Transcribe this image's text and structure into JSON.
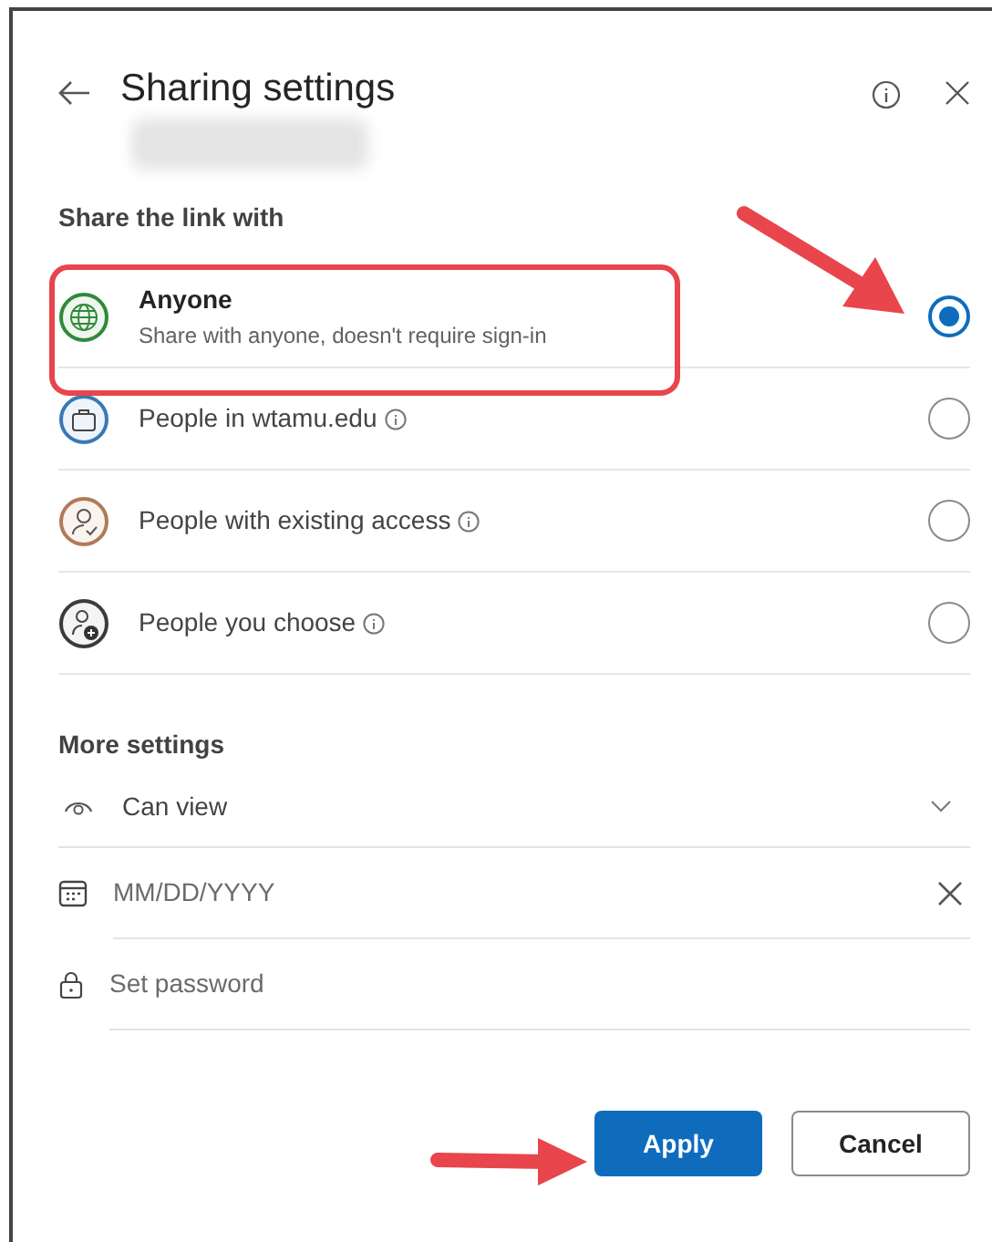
{
  "dialog": {
    "title": "Sharing settings"
  },
  "share_section": {
    "heading": "Share the link with",
    "options": [
      {
        "kind": "globe",
        "label": "Anyone",
        "description": "Share with anyone, doesn't require sign-in",
        "has_info": false,
        "selected": true,
        "color": "#2f8a3a"
      },
      {
        "kind": "organization",
        "label": "People in wtamu.edu",
        "has_info": true,
        "selected": false,
        "color": "#3a78b5"
      },
      {
        "kind": "existing",
        "label": "People with existing access",
        "has_info": true,
        "selected": false,
        "color": "#b07a5a"
      },
      {
        "kind": "specific",
        "label": "People you choose",
        "has_info": true,
        "selected": false,
        "color": "#3b3b3b"
      }
    ]
  },
  "more_settings": {
    "heading": "More settings",
    "permission": "Can view",
    "expiry": {
      "placeholder": "MM/DD/YYYY"
    },
    "password": {
      "placeholder": "Set password"
    }
  },
  "buttons": [
    {
      "label": "Apply",
      "kind": "primary"
    },
    {
      "label": "Cancel",
      "kind": "secondary"
    }
  ]
}
